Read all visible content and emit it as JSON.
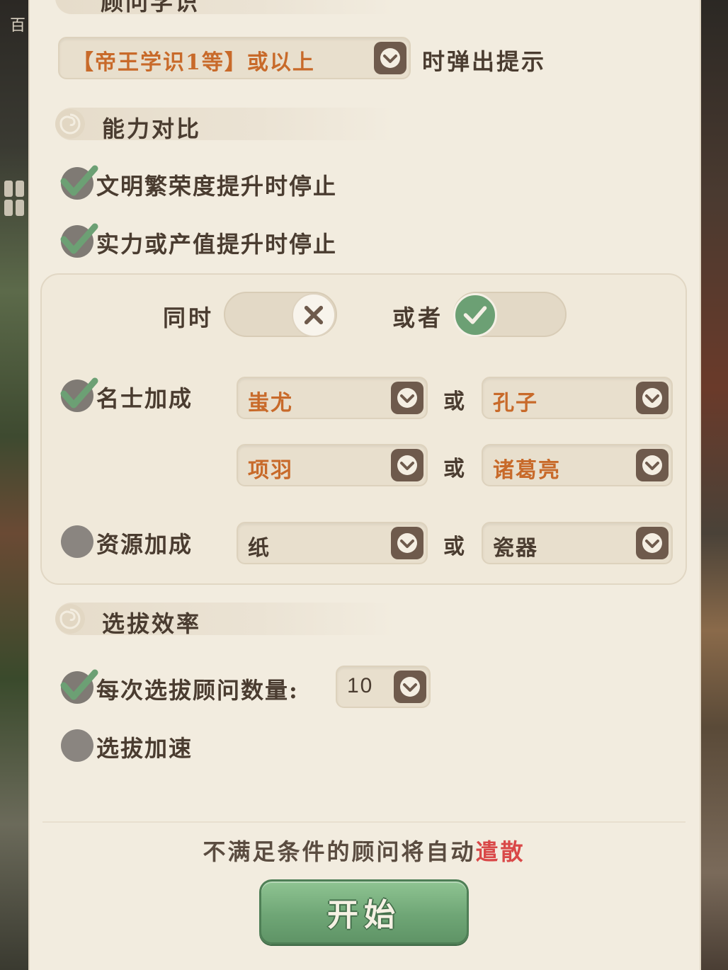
{
  "sections": {
    "advisor_knowledge": {
      "title": "顾问学识"
    },
    "ability_compare": {
      "title": "能力对比"
    },
    "selection_efficiency": {
      "title": "选拔效率"
    }
  },
  "prompt_row": {
    "dropdown_value": "【帝王学识1等】或以上",
    "suffix": "时弹出提示"
  },
  "checks": {
    "prosperity": {
      "label": "文明繁荣度提升时停止",
      "checked": true
    },
    "strength": {
      "label": "实力或产值提升时停止",
      "checked": true
    }
  },
  "logic_toggle": {
    "and_label": "同时",
    "or_label": "或者",
    "and_on": false,
    "or_on": true
  },
  "celebrity_bonus": {
    "label": "名士加成",
    "checked": true,
    "or_text": "或",
    "row1": {
      "left": "蚩尤",
      "right": "孔子"
    },
    "row2": {
      "left": "项羽",
      "right": "诸葛亮"
    }
  },
  "resource_bonus": {
    "label": "资源加成",
    "checked": false,
    "or_text": "或",
    "left": "纸",
    "right": "瓷器"
  },
  "efficiency": {
    "count_label": "每次选拔顾问数量:",
    "count_checked": true,
    "count_value": "10",
    "speedup_label": "选拔加速",
    "speedup_checked": false
  },
  "footer": {
    "notice_prefix": "不满足条件的顾问将自动",
    "notice_highlight": "遣散",
    "start_label": "开始"
  },
  "background": {
    "left_glyph": "百"
  },
  "colors": {
    "panel": "#f2ecdf",
    "orange_value": "#c86a2a",
    "green_check": "#6ca074",
    "red_highlight": "#d94848",
    "arrow_box": "#6e5a4c"
  }
}
